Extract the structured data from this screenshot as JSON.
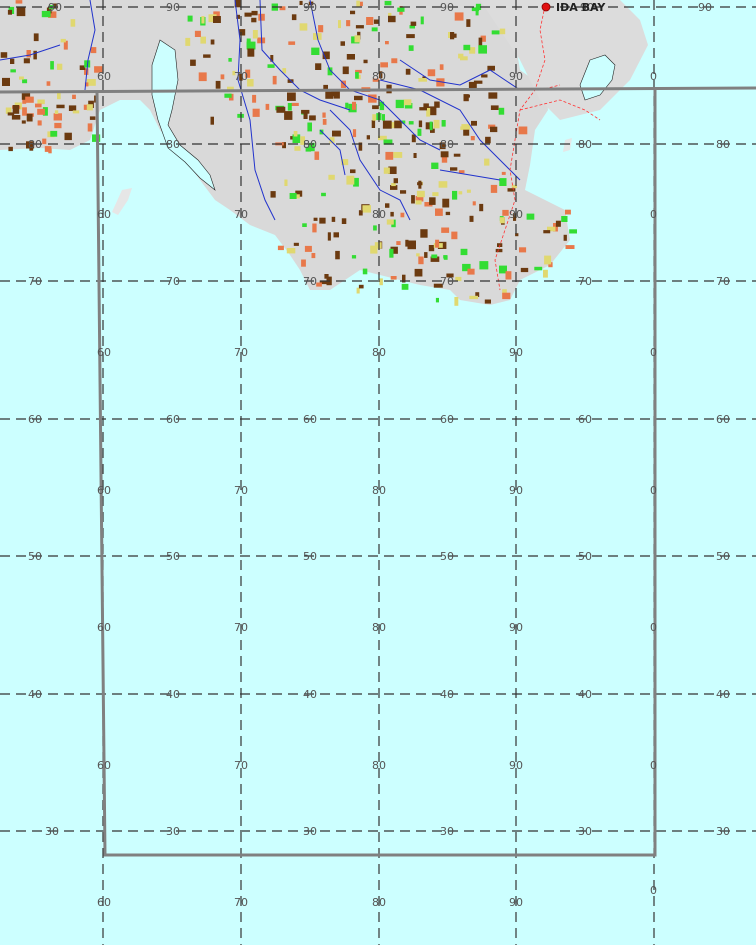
{
  "map": {
    "place": {
      "name": "IDA BAY",
      "marker_color": "#e01010"
    },
    "colors": {
      "sea": "#ccffff",
      "land": "#d9d9d9",
      "grid": "#444444",
      "boundary": "#808080",
      "river": "#2233cc",
      "track": "#ff3333",
      "forest_dark": "#6b3a10",
      "forest_orange": "#e8784a",
      "scrub_green": "#33dd33",
      "grass_yellow": "#e0d870"
    },
    "grid_labels": {
      "row_90": [
        "90",
        "90",
        "90",
        "90",
        "90",
        "90"
      ],
      "row_80": [
        "80",
        "80",
        "80",
        "80",
        "80",
        "80"
      ],
      "row_70": [
        "70",
        "70",
        "70",
        "70",
        "70",
        "70"
      ],
      "row_60": [
        "60",
        "60",
        "60",
        "60",
        "60",
        "60"
      ],
      "row_50": [
        "50",
        "50",
        "50",
        "50",
        "50",
        "50"
      ],
      "row_40": [
        "40",
        "40",
        "40",
        "40",
        "40",
        "40"
      ],
      "row_30": [
        "30",
        "30",
        "30",
        "30",
        "30",
        "30"
      ],
      "easting": [
        "60",
        "70",
        "80",
        "90",
        "0"
      ]
    }
  }
}
